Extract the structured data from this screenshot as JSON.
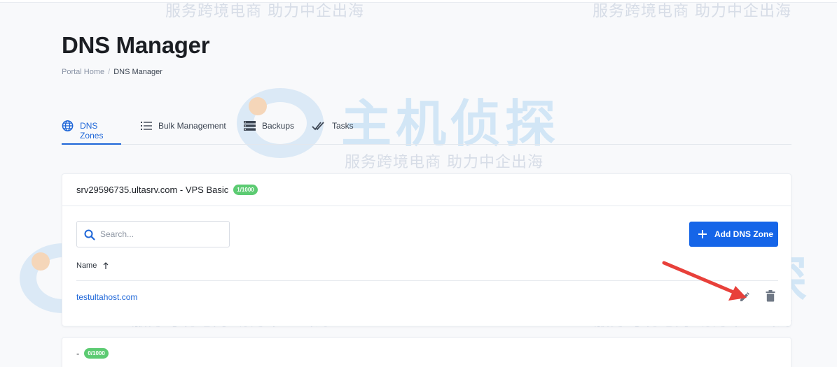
{
  "page": {
    "title": "DNS Manager",
    "breadcrumb": {
      "home": "Portal Home",
      "separator": "/",
      "current": "DNS Manager"
    }
  },
  "tabs": [
    {
      "label": "DNS Zones",
      "icon": "globe-icon",
      "active": true
    },
    {
      "label": "Bulk Management",
      "icon": "list-icon",
      "active": false
    },
    {
      "label": "Backups",
      "icon": "server-icon",
      "active": false
    },
    {
      "label": "Tasks",
      "icon": "double-check-icon",
      "active": false
    }
  ],
  "service_card": {
    "title": "srv29596735.ultasrv.com - VPS Basic",
    "badge": "1/1000",
    "search_placeholder": "Search...",
    "add_button": "Add DNS Zone",
    "column_header": "Name",
    "sort_icon": "arrow-up-icon",
    "zones": [
      {
        "name": "testultahost.com"
      }
    ]
  },
  "second_card": {
    "title": "-",
    "badge": "0/1000"
  },
  "watermark": {
    "logo_text": "主机侦探",
    "slogan": "服务跨境电商 助力中企出海"
  },
  "colors": {
    "accent": "#1e66d8",
    "badge": "#5ccb72",
    "button": "#1565e8",
    "arrow": "#e8403a"
  }
}
